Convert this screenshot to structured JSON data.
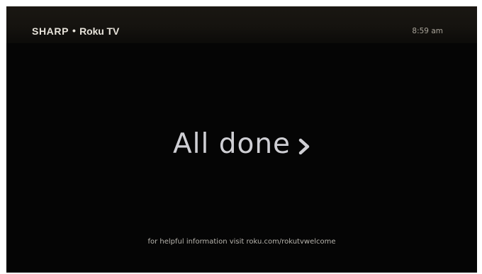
{
  "header": {
    "brand_sharp": "SHARP",
    "brand_separator": "•",
    "brand_roku": "Roku TV",
    "time": "8:59 am"
  },
  "main": {
    "action_label": "All done",
    "action_icon": "chevron-right-icon"
  },
  "footer": {
    "help_text": "for helpful information visit roku.com/rokutvwelcome"
  },
  "colors": {
    "screen_background": "#050505",
    "primary_text": "#cfcfd4",
    "secondary_text": "#b8b5ae"
  }
}
